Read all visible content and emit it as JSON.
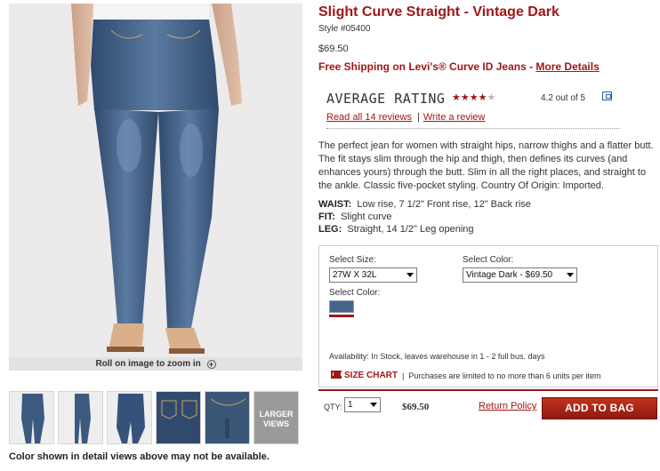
{
  "gallery": {
    "zoom_label": "Roll on image to zoom in",
    "zoom_icon": "plus-circle-icon",
    "larger_views_label": "LARGER VIEWS",
    "thumbnails": [
      "front-view",
      "side-view",
      "front-closeup",
      "back-closeup",
      "front-pocket-detail"
    ],
    "color_note": "Color shown in detail views above may not be available."
  },
  "product": {
    "title": "Slight Curve Straight - Vintage Dark",
    "style": "Style #05400",
    "price": "$69.50",
    "shipping_text": "Free Shipping on Levi's® Curve ID Jeans - ",
    "shipping_link": "More Details",
    "description": "The perfect jean for women with straight hips, narrow thighs and a flatter butt. The fit stays slim through the hip and thigh, then defines its curves (and enhances yours) through the butt. Slim in all the right places, and straight to the ankle. Classic five-pocket styling. Country Of Origin: Imported.",
    "specs": [
      {
        "label": "WAIST:",
        "value": "Low rise, 7 1/2\" Front rise, 12\" Back rise"
      },
      {
        "label": "FIT:",
        "value": "Slight curve"
      },
      {
        "label": "LEG:",
        "value": "Straight, 14 1/2\" Leg opening"
      }
    ]
  },
  "rating": {
    "label": "AVERAGE RATING",
    "stars_filled": "★★★★",
    "stars_empty": "★",
    "value": 4.2,
    "text": "4.2 out of 5",
    "read_reviews": "Read all 14 reviews",
    "separator": "|",
    "write_review": "Write a review",
    "popup_icon": "external-window-icon"
  },
  "options": {
    "size_label": "Select Size:",
    "size_value": "27W X 32L",
    "color_label": "Select Color:",
    "color_value": "Vintage Dark - $69.50",
    "swatch_label": "Select Color:",
    "swatch_color": "#46658a",
    "availability": "Availability: In Stock, leaves warehouse in 1 - 2 full bus. days",
    "size_chart": "SIZE CHART",
    "size_chart_icon": "ruler-icon",
    "limit_pipe": "|",
    "limit_text": "Purchases are limited to no more than 6 units per item"
  },
  "cart": {
    "qty_label": "QTY:",
    "qty_value": "1",
    "price": "$69.50",
    "return_policy": "Return Policy",
    "add_to_bag": "ADD TO BAG"
  },
  "colors": {
    "brand_red": "#a01717",
    "button_red": "#b02818"
  }
}
